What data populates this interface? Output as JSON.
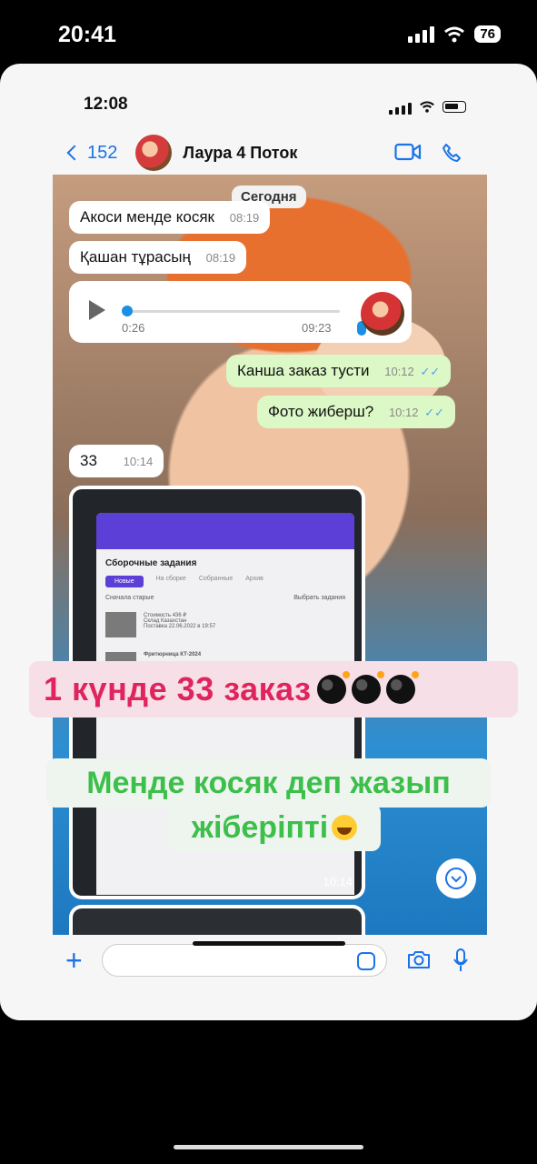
{
  "outer_status": {
    "time": "20:41",
    "battery": "76"
  },
  "inner_status": {
    "time": "12:08"
  },
  "header": {
    "back_count": "152",
    "contact_name": "Лаура 4 Поток"
  },
  "chat": {
    "date_label": "Сегодня",
    "messages": [
      {
        "text": "Акоси менде косяк",
        "time": "08:19",
        "direction": "incoming"
      },
      {
        "text": "Қашан тұрасың",
        "time": "08:19",
        "direction": "incoming"
      },
      {
        "voice_elapsed": "0:26",
        "voice_time": "09:23",
        "direction": "incoming"
      },
      {
        "text": "Канша заказ тусти",
        "time": "10:12",
        "direction": "outgoing"
      },
      {
        "text": "Фото жиберш?",
        "time": "10:12",
        "direction": "outgoing"
      },
      {
        "text": "33",
        "time": "10:14",
        "direction": "incoming"
      },
      {
        "photo_time": "10:14",
        "direction": "incoming"
      }
    ]
  },
  "screenshot_in_photo": {
    "title": "Сборочные задания",
    "tabs": [
      "Новые",
      "На сборке",
      "Собранные",
      "Архив"
    ],
    "sort_label": "Сначала старые",
    "select_label": "Выбрать задания",
    "item_title": "Фритюрница КТ-2024",
    "item_price": "Стоимость 436 ₽",
    "item_warehouse": "Склад Казахстан",
    "item_date": "Поставка 22.06.2022 в 19:57"
  },
  "overlays": {
    "line1": "1 күнде 33 заказ",
    "line2a": "Менде косяк деп жазып",
    "line2b": "жіберіпті"
  },
  "colors": {
    "accent": "#1a73e8",
    "out_bubble": "#dcf8c6",
    "overlay_pink": "#e0245e",
    "overlay_green": "#3cbf4b"
  }
}
